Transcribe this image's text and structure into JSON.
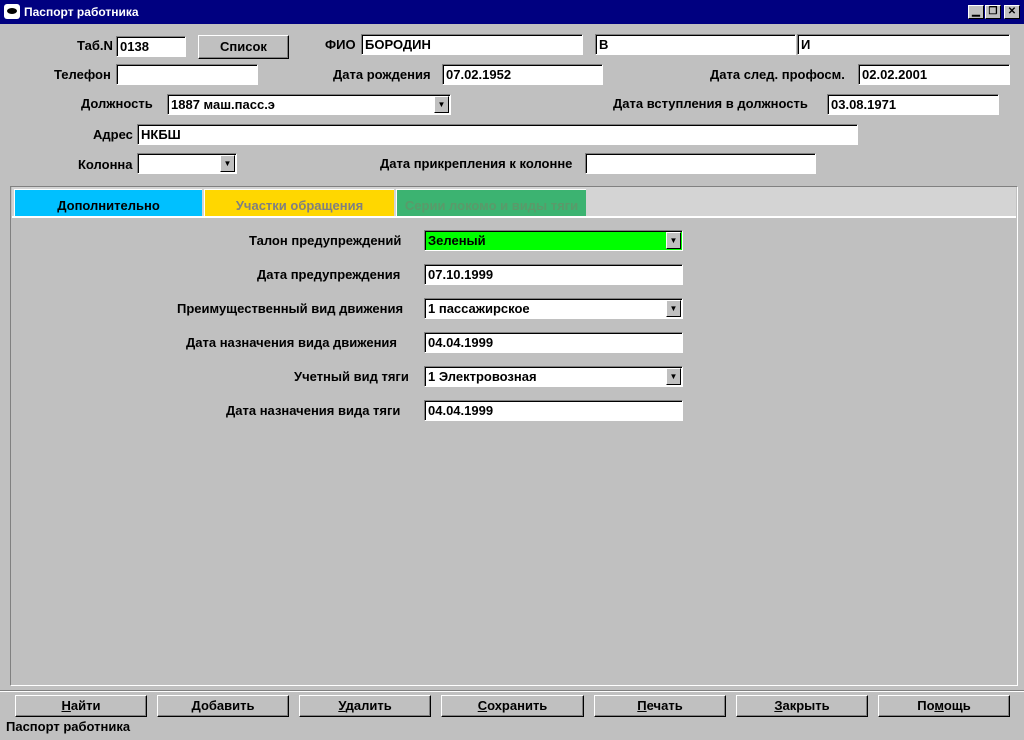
{
  "window": {
    "title": "Паспорт работника"
  },
  "header": {
    "tab_number": {
      "label": "Таб.N",
      "value": "0138"
    },
    "list_button": "Список",
    "fio": {
      "label": "ФИО",
      "last_name": "БОРОДИН",
      "first_initial": "В",
      "middle_initial": "И"
    },
    "phone": {
      "label": "Телефон",
      "value": ""
    },
    "birth_date": {
      "label": "Дата рождения",
      "value": "07.02.1952"
    },
    "next_medical": {
      "label": "Дата след. профосм.",
      "value": "02.02.2001"
    },
    "position": {
      "label": "Должность",
      "value": "1887 маш.пасс.э"
    },
    "position_start": {
      "label": "Дата вступления в должность",
      "value": "03.08.1971"
    },
    "address": {
      "label": "Адрес",
      "value": "НКБШ"
    },
    "column": {
      "label": "Колонна",
      "value": ""
    },
    "column_attach_date": {
      "label": "Дата прикрепления к колонне",
      "value": ""
    }
  },
  "tabs": [
    {
      "label": "Дополнительно",
      "color": "#00c0ff",
      "text_color": "#000000"
    },
    {
      "label": "Участки обращения",
      "color": "#ffd700",
      "text_color": "#808080"
    },
    {
      "label": "Серии локомо и виды тяги",
      "color": "#3cb371",
      "text_color": "#5a9a6a"
    }
  ],
  "details": {
    "warning_coupon": {
      "label": "Талон предупреждений",
      "value": "Зеленый",
      "color": "#00ff00"
    },
    "warning_date": {
      "label": "Дата предупреждения",
      "value": "07.10.1999"
    },
    "movement_type": {
      "label": "Преимущественный вид движения",
      "value": "1 пассажирское"
    },
    "movement_type_date": {
      "label": "Дата назначения вида движения",
      "value": "04.04.1999"
    },
    "traction_type": {
      "label": "Учетный вид тяги",
      "value": "1 Электровозная"
    },
    "traction_type_date": {
      "label": "Дата назначения вида тяги",
      "value": "04.04.1999"
    }
  },
  "buttons": {
    "find": {
      "underline": "Н",
      "rest": "айти"
    },
    "add": {
      "underline": "Д",
      "rest": "обавить"
    },
    "delete": {
      "underline": "У",
      "rest": "далить"
    },
    "save": {
      "underline": "С",
      "rest": "охранить"
    },
    "print": {
      "underline": "П",
      "rest": "ечать"
    },
    "close": {
      "underline": "З",
      "rest": "акрыть"
    },
    "help": {
      "before": "По",
      "underline": "м",
      "rest": "ощь"
    }
  },
  "status_bar": "Паспорт работника"
}
